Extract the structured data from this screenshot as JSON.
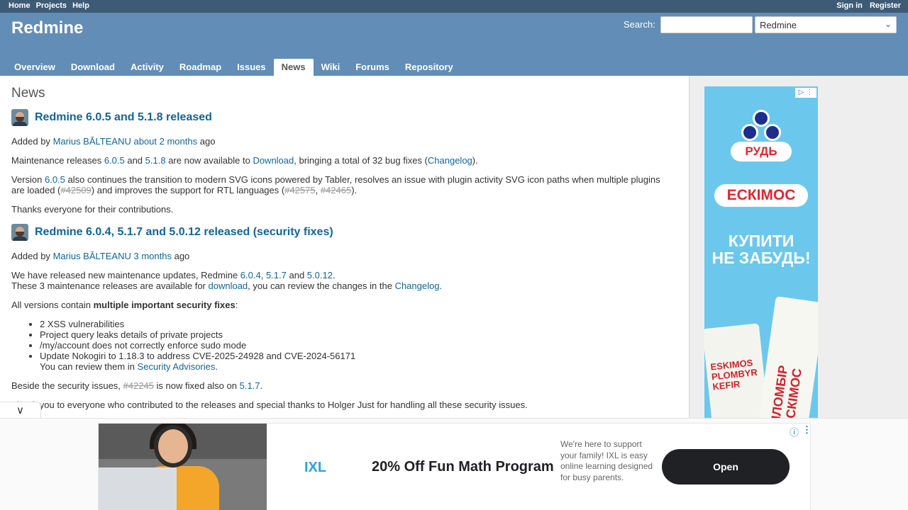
{
  "top_menu": {
    "left": [
      "Home",
      "Projects",
      "Help"
    ],
    "right": [
      "Sign in",
      "Register"
    ]
  },
  "header": {
    "title": "Redmine",
    "search_label": "Search:",
    "search_value": "",
    "project_select": "Redmine"
  },
  "main_menu": [
    "Overview",
    "Download",
    "Activity",
    "Roadmap",
    "Issues",
    "News",
    "Wiki",
    "Forums",
    "Repository"
  ],
  "page": {
    "title": "News"
  },
  "news": [
    {
      "title": "Redmine 6.0.5 and 5.1.8 released",
      "added_by_prefix": "Added by",
      "author": "Marius BĂLTEANU",
      "when": "about 2 months",
      "ago": "ago",
      "p1": {
        "a": "Maintenance releases ",
        "v1": "6.0.5",
        "b": " and ",
        "v2": "5.1.8",
        "c": " are now available to ",
        "dl": "Download",
        "d": ", bringing a total of 32 bug fixes (",
        "cl": "Changelog",
        "e": ")."
      },
      "p2": {
        "a": "Version ",
        "v": "6.0.5",
        "b": " also continues the transition to modern SVG icons powered by Tabler, resolves an issue with plugin activity SVG icon paths when multiple plugins are loaded (",
        "i1": "#42509",
        "c": ") and improves the support for RTL languages (",
        "i2": "#42575",
        "sep": ", ",
        "i3": "#42465",
        "d": ")."
      },
      "p3": "Thanks everyone for their contributions."
    },
    {
      "title": "Redmine 6.0.4, 5.1.7 and 5.0.12 released (security fixes)",
      "added_by_prefix": "Added by",
      "author": "Marius BĂLTEANU",
      "when": "3 months",
      "ago": "ago",
      "p1": {
        "a": "We have released new maintenance updates, Redmine ",
        "v1": "6.0.4",
        "s1": ", ",
        "v2": "5.1.7",
        "s2": " and ",
        "v3": "5.0.12",
        "end": "."
      },
      "p1b": {
        "a": "These 3 maintenance releases are available for ",
        "dl": "download",
        "b": ", you can review the changes in the ",
        "cl": "Changelog",
        "c": "."
      },
      "p2": {
        "a": "All versions contain ",
        "bold": "multiple important security fixes",
        "b": ":"
      },
      "bullets": [
        "2 XSS vulnerabilities",
        "Project query leaks details of private projects",
        "/my/account does not correctly enforce sudo mode",
        "Update Nokogiri to 1.18.3 to address CVE-2025-24928 and CVE-2024-56171"
      ],
      "review": {
        "a": "You can review them in ",
        "link": "Security Advisories",
        "b": "."
      },
      "p3": {
        "a": "Beside the security issues, ",
        "issue": "#42245",
        "b": " is now fixed also on ",
        "v": "5.1.7",
        "c": "."
      },
      "p4": "Thank you to everyone who contributed to the releases and special thanks to Holger Just for handling all these security issues."
    }
  ],
  "side_ad": {
    "brand": "РУДЬ",
    "product": "ЕСКІМОС",
    "tagline_1": "КУПИТИ",
    "tagline_2": "НЕ ЗАБУДЬ!",
    "pack_left": "ESKIMOS PLOMBYR KEFIR",
    "pack_right": "ПЛОМБІР ЕСКІМОС"
  },
  "bottom_ad": {
    "logo": "IXL",
    "headline": "20% Off Fun Math Program",
    "description": "We're here to support your family! IXL is easy online learning designed for busy parents.",
    "cta": "Open"
  },
  "colors": {
    "top_bar": "#3E5B76",
    "header": "#628DB6",
    "link": "#169",
    "sidebar": "#EEEEEE"
  }
}
